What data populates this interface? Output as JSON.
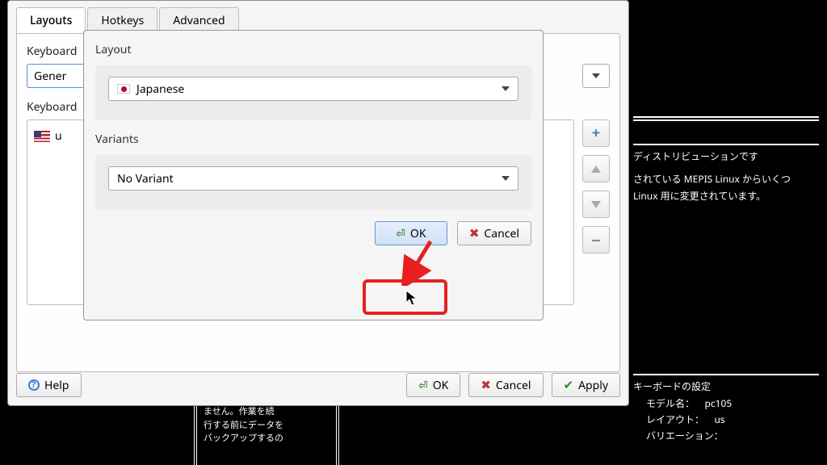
{
  "tabs": {
    "layouts": "Layouts",
    "hotkeys": "Hotkeys",
    "advanced": "Advanced"
  },
  "main": {
    "model_label": "Keyboard",
    "model_value": "Gener",
    "layout_label": "Keyboard",
    "layout_item": "u"
  },
  "dialog": {
    "layout_label": "Layout",
    "layout_value": "Japanese",
    "variants_label": "Variants",
    "variant_value": "No Variant",
    "ok": "OK",
    "cancel": "Cancel"
  },
  "footer": {
    "help": "Help",
    "ok": "OK",
    "cancel": "Cancel",
    "apply": "Apply"
  },
  "terminal": {
    "line1": "ディストリビューションです",
    "line2": "されている MEPIS Linux からいくつ",
    "line3": "Linux 用に変更されています。",
    "kb_title": "キーボードの設定",
    "kb_model_label": "モデル名：",
    "kb_model_value": "pc105",
    "kb_layout_label": "レイアウト：",
    "kb_layout_value": "us",
    "kb_variation_label": "バリエーション："
  },
  "snippet": {
    "l1": "ません。作業を続",
    "l2": "行する前にデータを",
    "l3": "バックアップするの"
  }
}
